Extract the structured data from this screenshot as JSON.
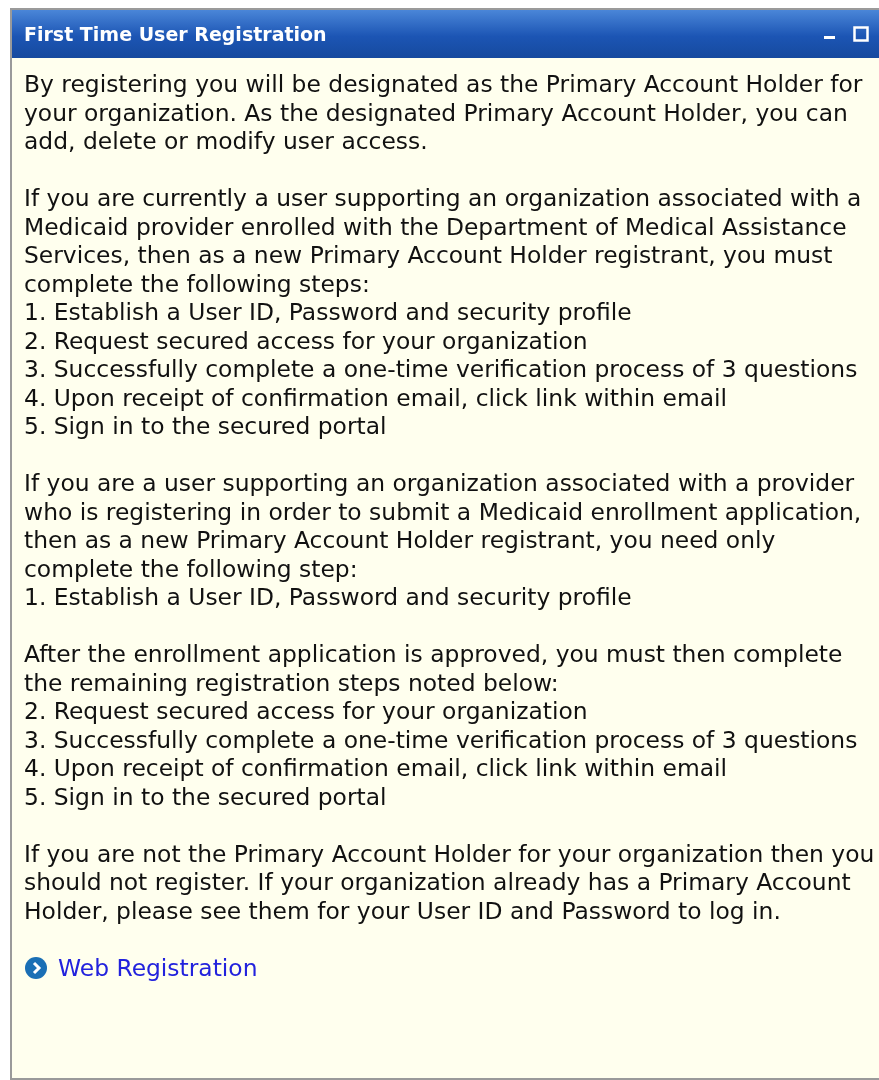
{
  "panel": {
    "title": "First Time User Registration"
  },
  "sections": [
    {
      "text": "By registering you will be designated as the Primary Account Holder for your organization. As the designated Primary Account Holder, you can add, delete or modify user access."
    },
    {
      "text": "If you are currently a user supporting an organization associated with a Medicaid provider enrolled with the Department of Medical Assistance Services, then as a new Primary Account Holder registrant, you must complete the following steps:",
      "steps": [
        "1. Establish a User ID, Password and security profile",
        "2. Request secured access for your organization",
        "3. Successfully complete a one-time verification process of 3 questions",
        "4. Upon receipt of confirmation email, click link within email",
        "5. Sign in to the secured portal"
      ]
    },
    {
      "text": "If you are a user supporting an organization associated with a provider who is registering in order to submit a Medicaid enrollment application, then as a new Primary Account Holder registrant, you need only complete the following step:",
      "steps": [
        "1. Establish a User ID, Password and security profile"
      ]
    },
    {
      "text": "After the enrollment application is approved, you must then complete the remaining registration steps noted below:",
      "steps": [
        "2. Request secured access for your organization",
        "3. Successfully complete a one-time verification process of 3 questions",
        "4. Upon receipt of confirmation email, click link within email",
        "5. Sign in to the secured portal"
      ]
    },
    {
      "text": "If you are not the Primary Account Holder for your organization then you should not register. If your organization already has a Primary Account Holder, please see them for your User ID and Password to log in."
    }
  ],
  "link": {
    "label": "Web Registration"
  }
}
